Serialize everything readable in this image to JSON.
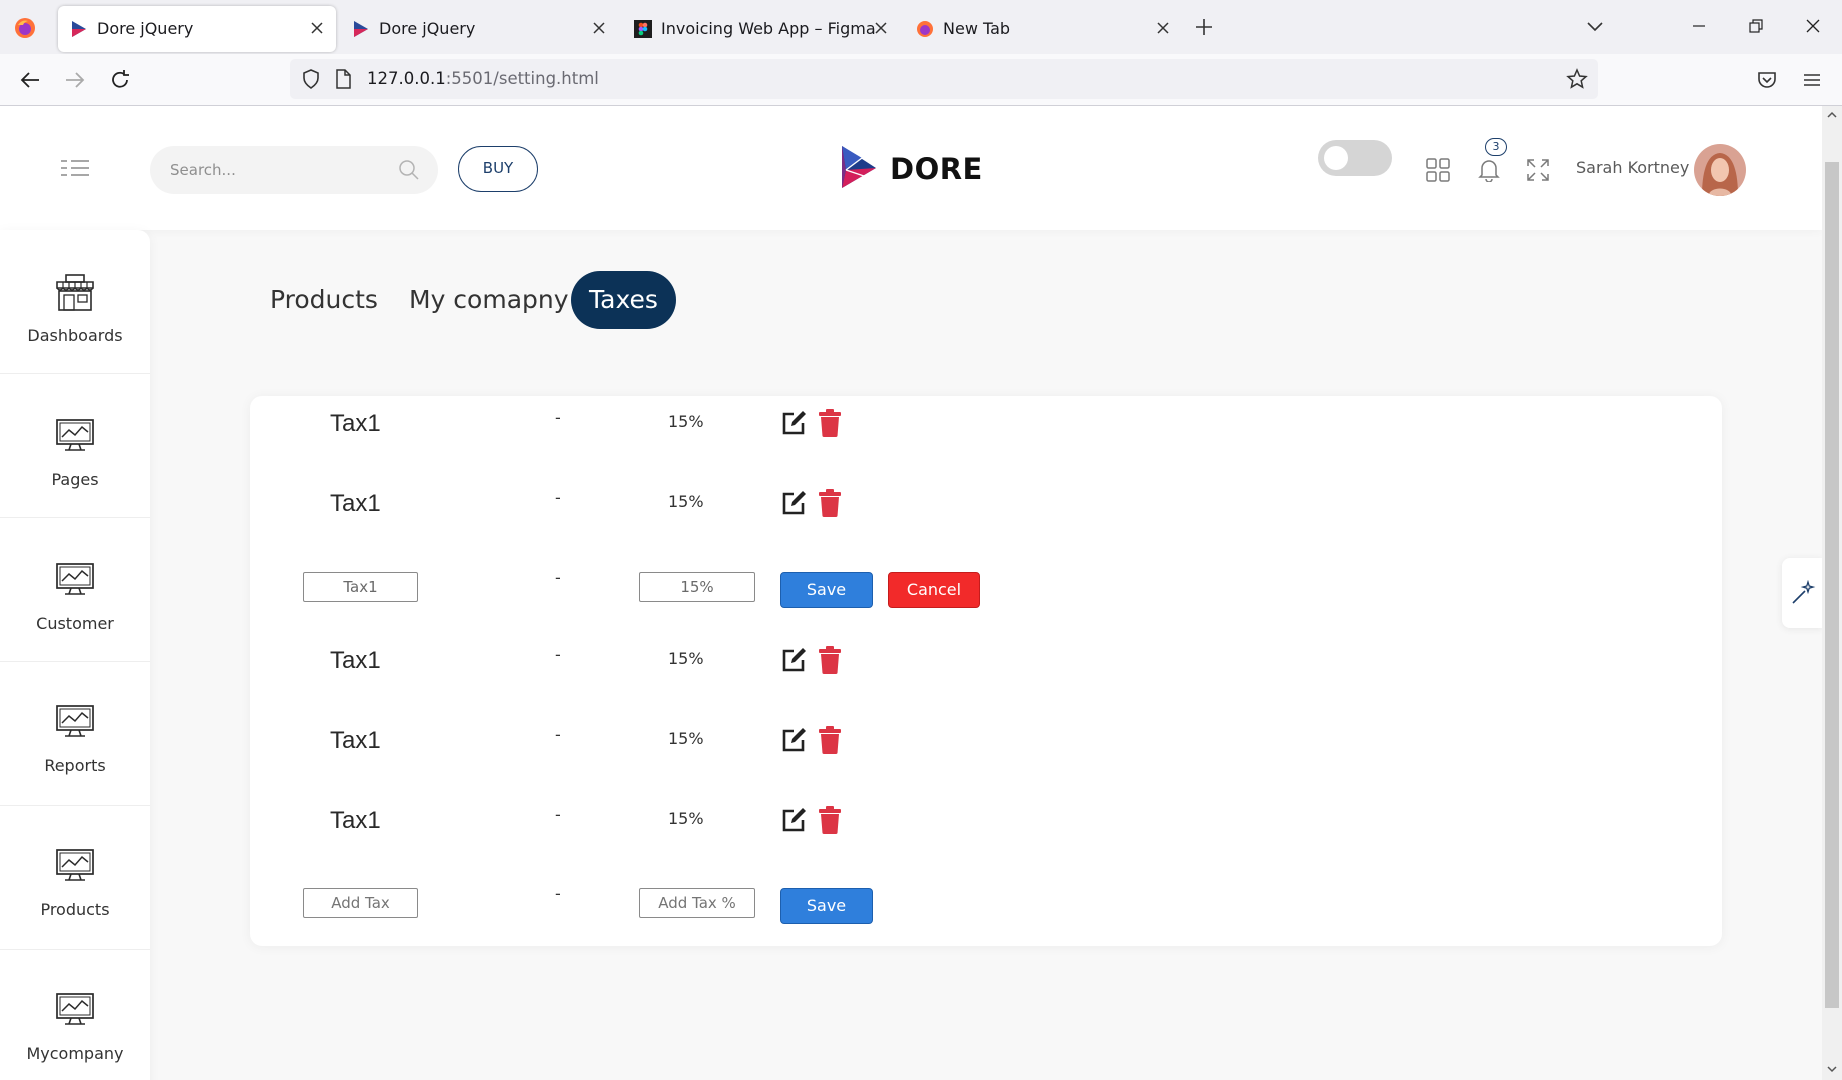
{
  "browser": {
    "tabs": [
      {
        "title": "Dore jQuery",
        "active": true
      },
      {
        "title": "Dore jQuery",
        "active": false
      },
      {
        "title": "Invoicing Web App – Figma",
        "active": false
      },
      {
        "title": "New Tab",
        "active": false
      }
    ],
    "url_host": "127.0.0.1",
    "url_rest": ":5501/setting.html"
  },
  "header": {
    "search_placeholder": "Search...",
    "buy_label": "BUY",
    "brand_name": "DORE",
    "notification_count": "3",
    "user_name": "Sarah Kortney"
  },
  "sidebar": {
    "items": [
      {
        "label": "Dashboards",
        "icon": "shop-icon"
      },
      {
        "label": "Pages",
        "icon": "monitor-chart-icon"
      },
      {
        "label": "Customer",
        "icon": "monitor-chart-icon"
      },
      {
        "label": "Reports",
        "icon": "monitor-chart-icon"
      },
      {
        "label": "Products",
        "icon": "monitor-chart-icon"
      },
      {
        "label": "Mycompany",
        "icon": "monitor-chart-icon"
      }
    ]
  },
  "page_tabs": [
    {
      "label": "Products",
      "active": false
    },
    {
      "label": "My comapny",
      "active": false
    },
    {
      "label": "Taxes",
      "active": true
    }
  ],
  "taxes": {
    "rows": [
      {
        "mode": "view",
        "name": "Tax1",
        "separator": "-",
        "percent": "15%"
      },
      {
        "mode": "view",
        "name": "Tax1",
        "separator": "-",
        "percent": "15%"
      },
      {
        "mode": "edit",
        "name": "Tax1",
        "separator": "-",
        "percent": "15%",
        "save_label": "Save",
        "cancel_label": "Cancel"
      },
      {
        "mode": "view",
        "name": "Tax1",
        "separator": "-",
        "percent": "15%"
      },
      {
        "mode": "view",
        "name": "Tax1",
        "separator": "-",
        "percent": "15%"
      },
      {
        "mode": "view",
        "name": "Tax1",
        "separator": "-",
        "percent": "15%"
      }
    ],
    "add_row": {
      "name_placeholder": "Add Tax",
      "separator": "-",
      "percent_placeholder": "Add Tax %",
      "save_label": "Save"
    }
  },
  "colors": {
    "active_tab_bg": "#0c3257",
    "save_button": "#2f7fdc",
    "cancel_button": "#f22a2a",
    "delete_icon": "#dc3545"
  }
}
